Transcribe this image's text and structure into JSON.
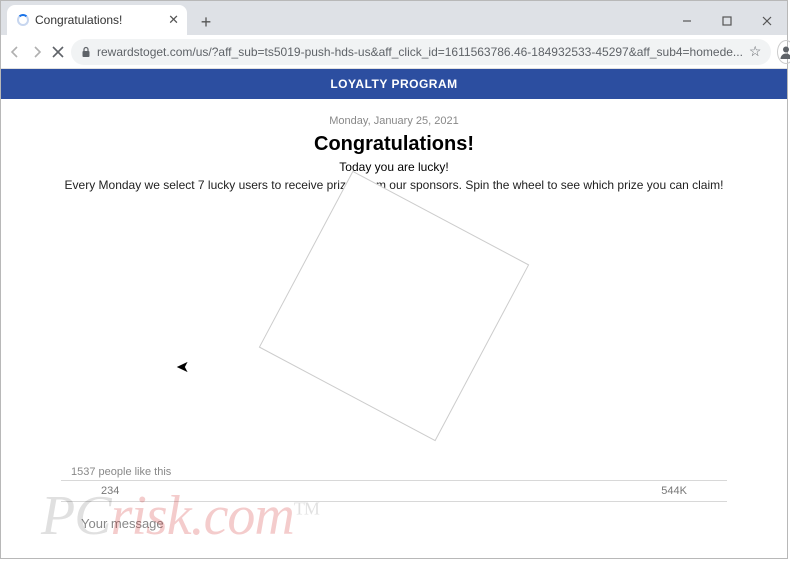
{
  "browser": {
    "tab_title": "Congratulations!",
    "url": "rewardstoget.com/us/?aff_sub=ts5019-push-hds-us&aff_click_id=1611563786.46-184932533-45297&aff_sub4=homede..."
  },
  "page": {
    "banner": "LOYALTY PROGRAM",
    "date": "Monday, January 25, 2021",
    "heading": "Congratulations!",
    "subheading": "Today you are lucky!",
    "description": "Every Monday we select 7 lucky users to receive prizes from our sponsors. Spin the wheel to see which prize you can claim!",
    "likes_text": "1537 people like this",
    "bar_left": "234",
    "bar_right": "544K",
    "message_placeholder": "Your message"
  },
  "watermark": {
    "left": "PC",
    "right": "risk.com",
    "tm": "TM"
  }
}
